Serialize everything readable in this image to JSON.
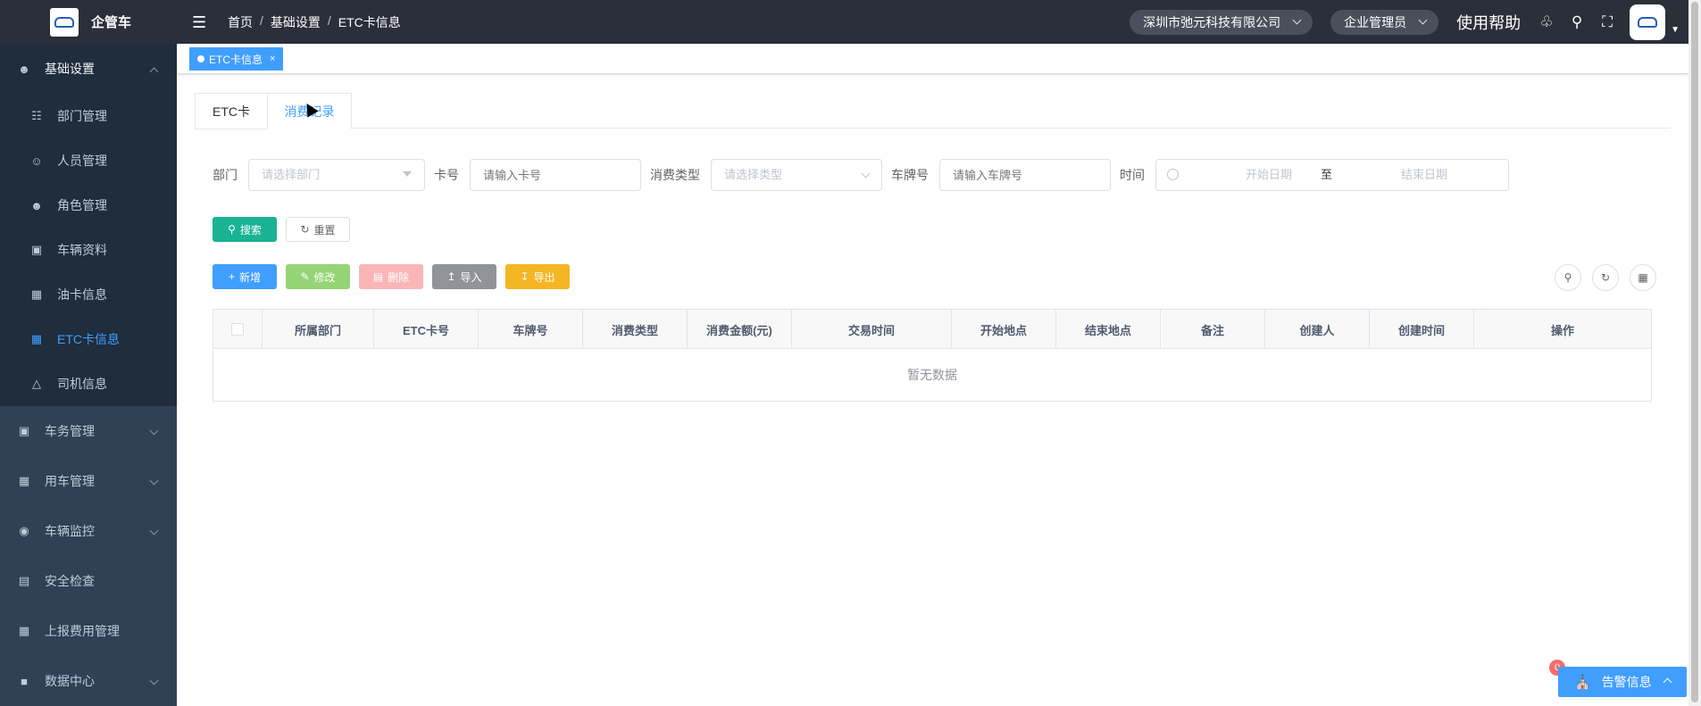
{
  "app": {
    "name": "企管车"
  },
  "sidebar": {
    "groups": [
      {
        "label": "基础设置",
        "icon": "users-icon",
        "open": true
      },
      {
        "label": "车务管理",
        "icon": "monitor-icon"
      },
      {
        "label": "用车管理",
        "icon": "truck-icon"
      },
      {
        "label": "车辆监控",
        "icon": "globe-icon"
      },
      {
        "label": "安全检查",
        "icon": "calendar-icon"
      },
      {
        "label": "上报费用管理",
        "icon": "grid-icon"
      },
      {
        "label": "数据中心",
        "icon": "lock-icon"
      }
    ],
    "sub_items": [
      {
        "label": "部门管理",
        "icon": "tree-icon"
      },
      {
        "label": "人员管理",
        "icon": "user-icon"
      },
      {
        "label": "角色管理",
        "icon": "peoples-icon"
      },
      {
        "label": "车辆资料",
        "icon": "monitor-icon"
      },
      {
        "label": "油卡信息",
        "icon": "card-icon"
      },
      {
        "label": "ETC卡信息",
        "icon": "card-icon",
        "active": true
      },
      {
        "label": "司机信息",
        "icon": "car-icon"
      }
    ]
  },
  "navbar": {
    "breadcrumb": [
      "首页",
      "基础设置",
      "ETC卡信息"
    ],
    "company": "深圳市弛元科技有限公司",
    "role": "企业管理员",
    "help": "使用帮助"
  },
  "tags_view": {
    "active_tag": "ETC卡信息"
  },
  "tabs": [
    "ETC卡",
    "消费记录"
  ],
  "filters": {
    "dept_label": "部门",
    "dept_placeholder": "请选择部门",
    "card_label": "卡号",
    "card_placeholder": "请输入卡号",
    "type_label": "消费类型",
    "type_placeholder": "请选择类型",
    "plate_label": "车牌号",
    "plate_placeholder": "请输入车牌号",
    "time_label": "时间",
    "start_placeholder": "开始日期",
    "range_sep": "至",
    "end_placeholder": "结束日期"
  },
  "buttons": {
    "search": "搜索",
    "reset": "重置",
    "add": "新增",
    "edit": "修改",
    "delete": "删除",
    "import": "导入",
    "export": "导出"
  },
  "table": {
    "columns": [
      "所属部门",
      "ETC卡号",
      "车牌号",
      "消费类型",
      "消费金额(元)",
      "交易时间",
      "开始地点",
      "结束地点",
      "备注",
      "创建人",
      "创建时间",
      "操作"
    ],
    "empty_text": "暂无数据"
  },
  "alert": {
    "label": "告警信息",
    "count": "0"
  },
  "colors": {
    "sidebar": "#304156",
    "navbar": "#2b2f3a",
    "primary": "#409eff"
  }
}
